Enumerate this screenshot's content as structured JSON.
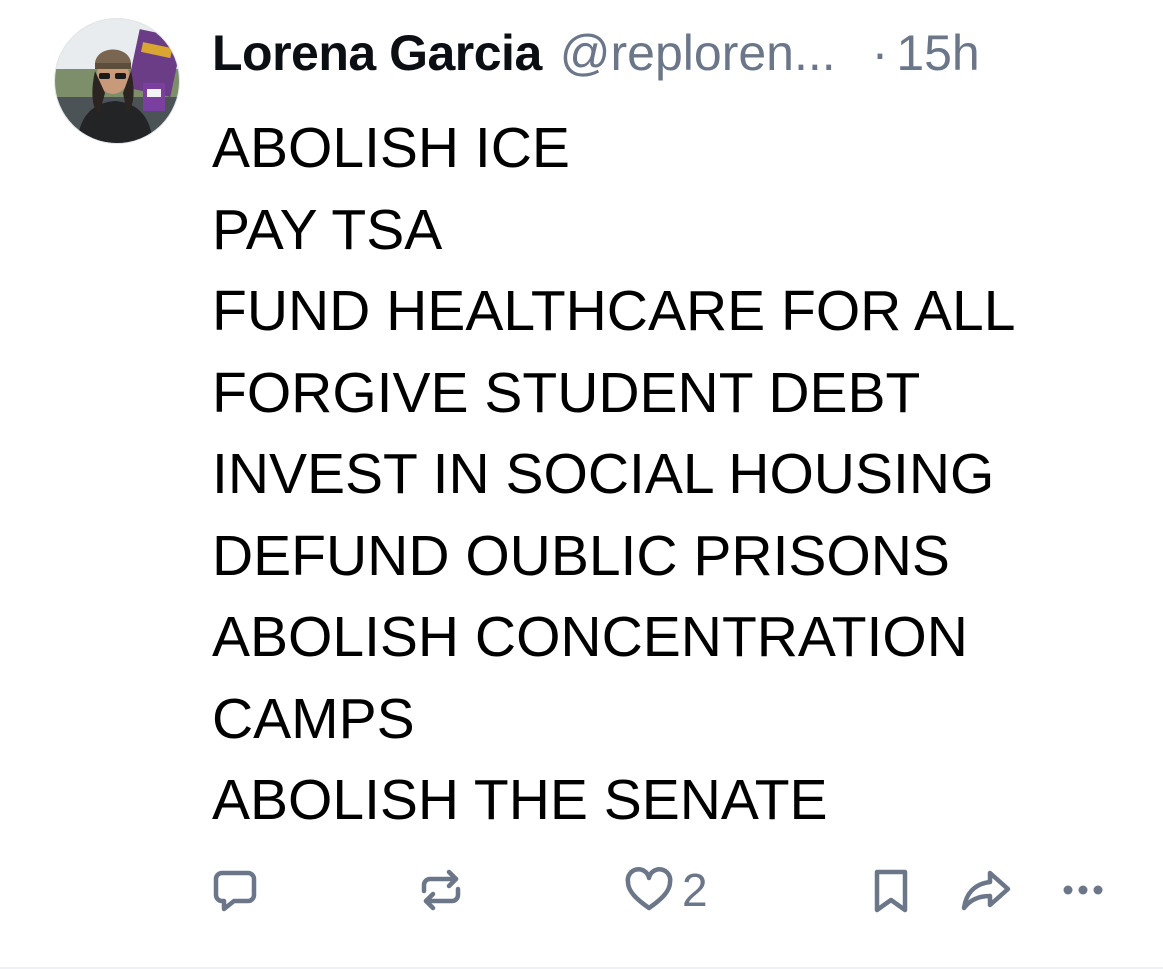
{
  "post": {
    "author": {
      "display_name": "Lorena Garcia",
      "handle": "@reploren...",
      "separator": "·",
      "timestamp": "15h"
    },
    "text_lines": [
      "ABOLISH ICE",
      "PAY TSA",
      "FUND HEALTHCARE FOR ALL",
      "FORGIVE STUDENT DEBT",
      "INVEST IN SOCIAL HOUSING",
      "DEFUND OUBLIC PRISONS",
      "ABOLISH CONCENTRATION",
      "CAMPS",
      "ABOLISH THE SENATE"
    ],
    "actions": {
      "like_count": "2"
    }
  },
  "icons": [
    "reply-icon",
    "repost-icon",
    "heart-icon",
    "bookmark-icon",
    "share-icon",
    "more-options-icon"
  ],
  "colors": {
    "text": "#000000",
    "muted": "#6b7789",
    "background": "#ffffff"
  }
}
